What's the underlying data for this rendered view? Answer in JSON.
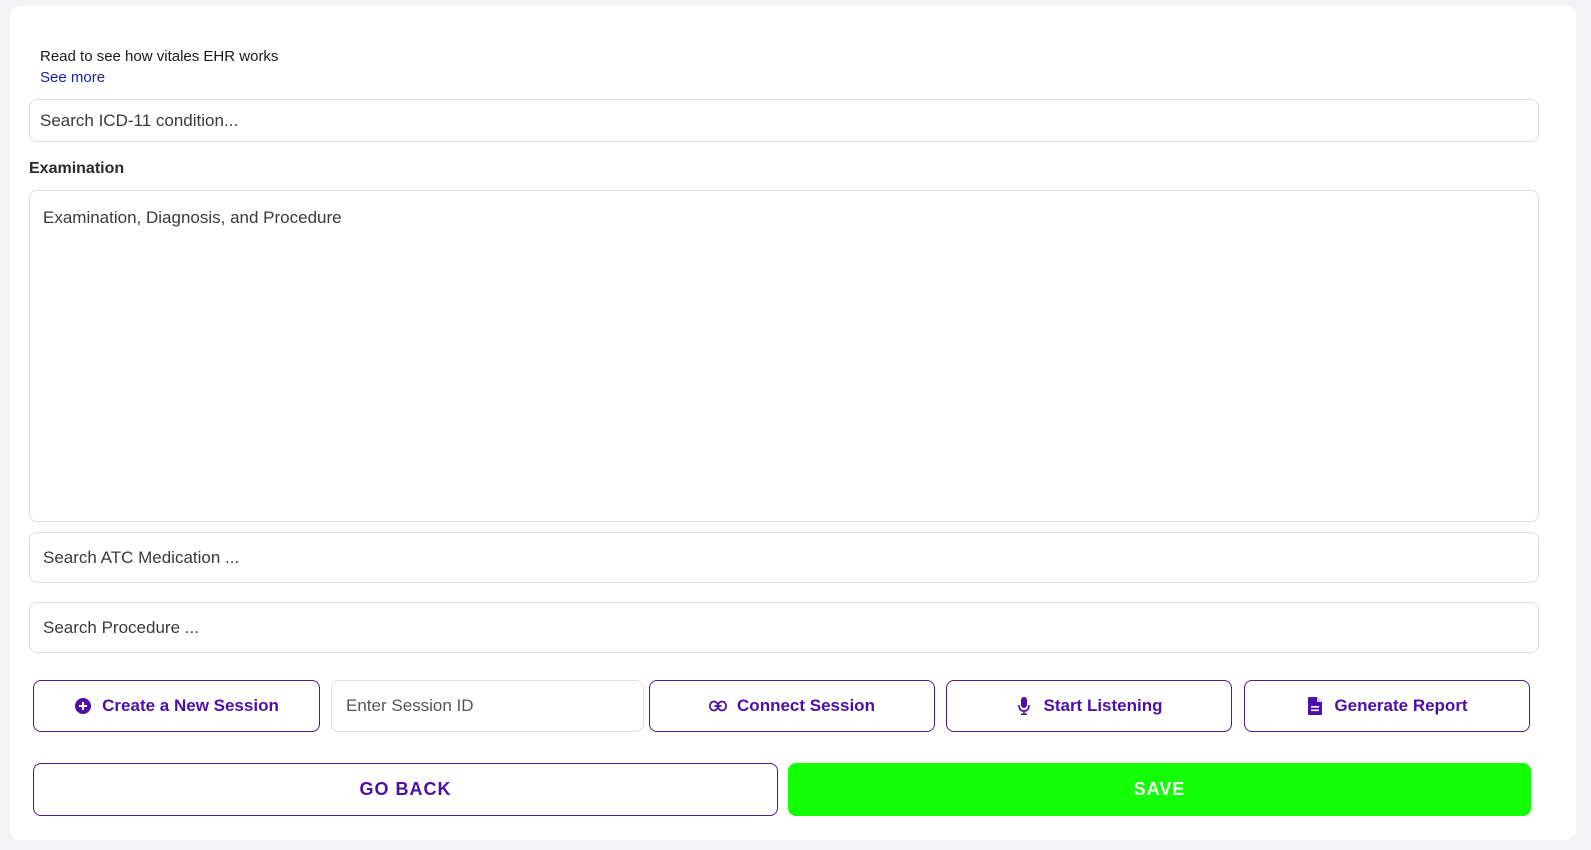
{
  "intro": {
    "text": "Read to see how vitales EHR works",
    "link": "See more"
  },
  "icd_search": {
    "placeholder": "Search ICD-11 condition..."
  },
  "examination": {
    "label": "Examination",
    "placeholder": "Examination, Diagnosis, and Procedure"
  },
  "medication_search": {
    "placeholder": "Search ATC Medication ..."
  },
  "procedure_search": {
    "placeholder": "Search Procedure ..."
  },
  "session": {
    "create_label": "Create a New Session",
    "session_id_placeholder": "Enter Session ID",
    "connect_label": "Connect Session",
    "listen_label": "Start Listening",
    "report_label": "Generate Report"
  },
  "actions": {
    "back_label": "GO BACK",
    "save_label": "SAVE"
  },
  "colors": {
    "accent": "#4a10a8",
    "save": "#14ff06",
    "link": "#1b22a6"
  }
}
